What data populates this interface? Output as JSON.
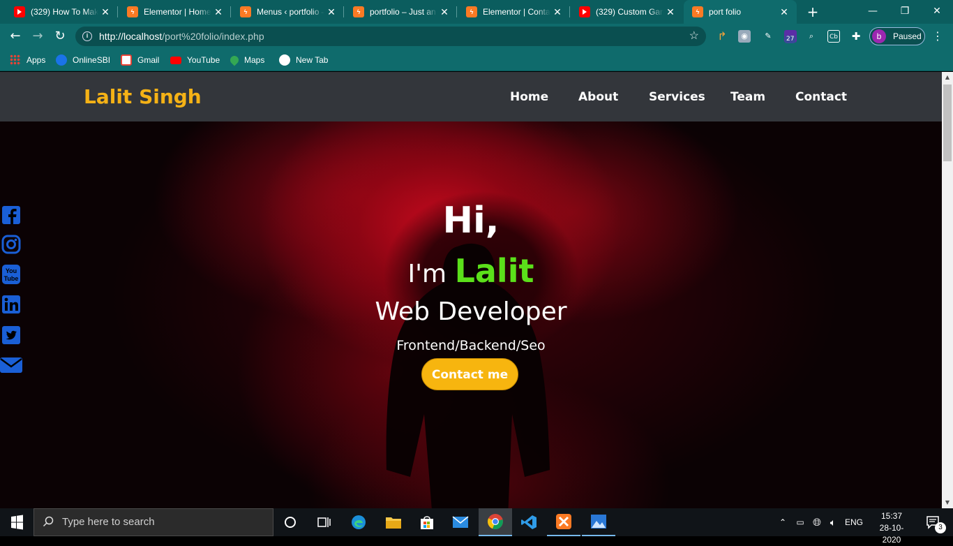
{
  "browser": {
    "tabs": [
      {
        "title": "(329) How To Make",
        "icon": "youtube-icon"
      },
      {
        "title": "Elementor | Home",
        "icon": "xampp-icon"
      },
      {
        "title": "Menus ‹ portfolio —",
        "icon": "xampp-icon"
      },
      {
        "title": "portfolio – Just an",
        "icon": "xampp-icon"
      },
      {
        "title": "Elementor | Contac",
        "icon": "xampp-icon"
      },
      {
        "title": "(329) Custom Gam",
        "icon": "youtube-icon"
      },
      {
        "title": "port folio",
        "icon": "xampp-icon",
        "active": true
      }
    ],
    "url_host": "http://localhost",
    "url_path": "/port%20folio/index.php",
    "extension_badge": "27",
    "profile_initial": "b",
    "profile_status": "Paused",
    "bookmarks": [
      {
        "label": "Apps",
        "icon": "apps-grid-icon"
      },
      {
        "label": "OnlineSBI",
        "icon": "onlinesbi-icon"
      },
      {
        "label": "Gmail",
        "icon": "gmail-icon"
      },
      {
        "label": "YouTube",
        "icon": "youtube-icon"
      },
      {
        "label": "Maps",
        "icon": "maps-icon"
      },
      {
        "label": "New Tab",
        "icon": "globe-icon"
      }
    ]
  },
  "site": {
    "brand": "Lalit Singh",
    "nav": [
      "Home",
      "About",
      "Services",
      "Team",
      "Contact"
    ],
    "hero": {
      "greeting": "Hi,",
      "intro_prefix": "I'm",
      "name": "Lalit",
      "role": "Web Developer",
      "skills": "Frontend/Backend/Seo",
      "cta": "Contact me"
    },
    "social": [
      "facebook-icon",
      "instagram-icon",
      "youtube-icon",
      "linkedin-icon",
      "twitter-icon",
      "email-icon"
    ],
    "colors": {
      "brand": "#f5b216",
      "name_highlight": "#5be01a",
      "cta": "#f7b50f",
      "nav_bg": "#33363b",
      "social": "#1a5fd6"
    }
  },
  "taskbar": {
    "search_placeholder": "Type here to search",
    "language": "ENG",
    "time": "15:37",
    "date": "28-10-2020",
    "notification_count": "3"
  }
}
